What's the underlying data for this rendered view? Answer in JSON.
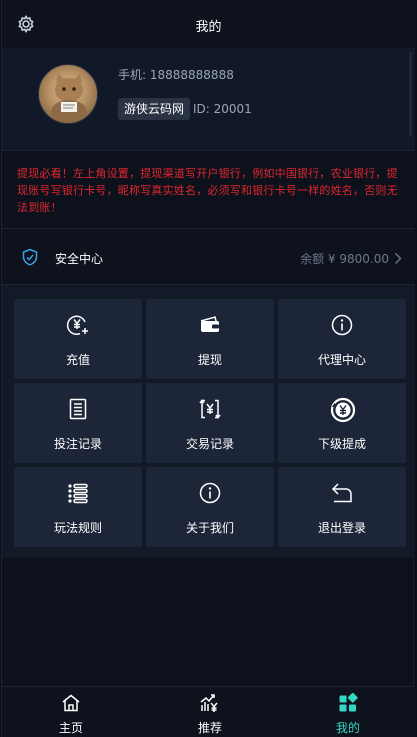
{
  "header": {
    "title": "我的",
    "settings_icon": "gear-icon"
  },
  "profile": {
    "phone": "手机: 18888888888",
    "tag": "游侠云码网",
    "uid": "ID: 20001"
  },
  "notice": "提现必看！左上角设置，提现渠道写开户银行，例如中国银行，农业银行，提现账号写银行卡号，昵称写真实姓名，必须写和银行卡号一样的姓名，否则无法到账！",
  "security": {
    "label": "安全中心",
    "balance": "余额 ¥ 9800.00",
    "icon": "shield-icon"
  },
  "menu": [
    {
      "label": "充值",
      "icon": "recharge-icon"
    },
    {
      "label": "提现",
      "icon": "wallet-icon"
    },
    {
      "label": "代理中心",
      "icon": "info-icon"
    },
    {
      "label": "投注记录",
      "icon": "document-icon"
    },
    {
      "label": "交易记录",
      "icon": "exchange-icon"
    },
    {
      "label": "下级提成",
      "icon": "commission-icon"
    },
    {
      "label": "玩法规则",
      "icon": "list-icon"
    },
    {
      "label": "关于我们",
      "icon": "info-icon"
    },
    {
      "label": "退出登录",
      "icon": "return-icon"
    }
  ],
  "bottom_nav": [
    {
      "label": "主页",
      "icon": "home-icon",
      "active": false
    },
    {
      "label": "推荐",
      "icon": "trend-icon",
      "active": false
    },
    {
      "label": "我的",
      "icon": "grid-icon",
      "active": true
    }
  ],
  "colors": {
    "accent": "#36d6c4",
    "notice": "#e0262f",
    "tile": "#1d2638",
    "background": "#0c111b"
  }
}
